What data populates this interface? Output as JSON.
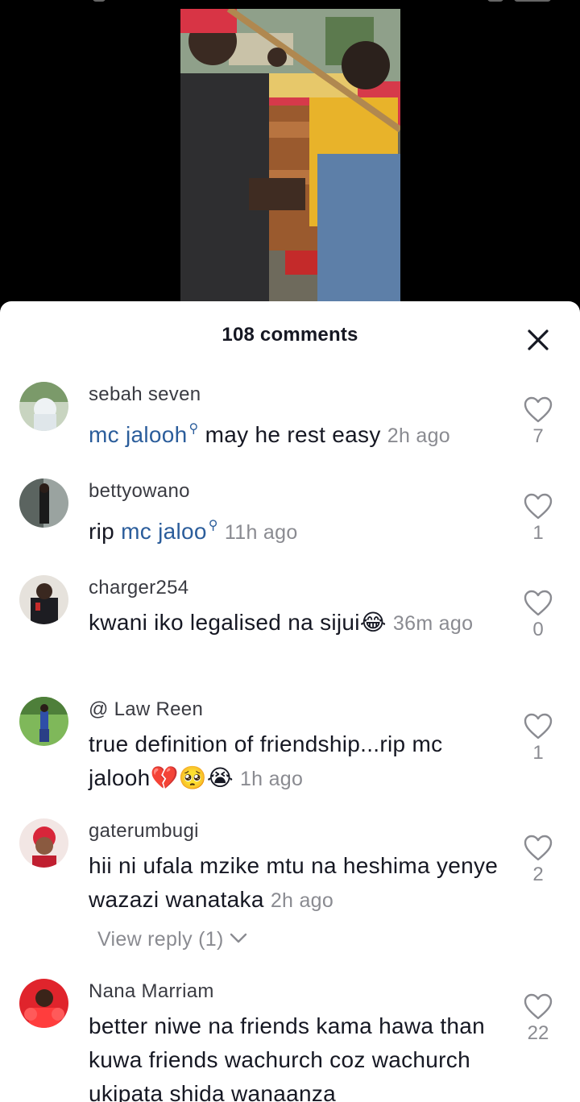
{
  "video": {
    "description_shown": true
  },
  "sheet": {
    "title": "108 comments"
  },
  "comments": [
    {
      "username": "sebah seven",
      "mention": "mc jalooh",
      "text": " may he rest easy ",
      "time": "2h ago",
      "likes": "7"
    },
    {
      "username": "bettyowano",
      "prefix": "rip ",
      "mention": "mc jaloo",
      "time": "11h ago",
      "likes": "1"
    },
    {
      "username": "charger254",
      "text": "kwani iko legalised na sijui😂 ",
      "time": "36m ago",
      "likes": "0"
    },
    {
      "username": "@ Law Reen",
      "text": "true definition of friendship...rip mc jalooh💔🥺😭 ",
      "time": "1h ago",
      "likes": "1"
    },
    {
      "username": "gaterumbugi",
      "text": "hii ni ufala mzike mtu na heshima yenye wazazi wanataka ",
      "time": "2h ago",
      "likes": "2",
      "view_reply": "View reply (1)"
    },
    {
      "username": "Nana Marriam",
      "text": "better niwe na friends kama hawa than kuwa friends wachurch coz wachurch ukipata shida wanaanza",
      "likes": "22"
    }
  ],
  "colors": {
    "mention": "#2b5d9b",
    "muted": "#8a8b91",
    "text": "#161823"
  }
}
